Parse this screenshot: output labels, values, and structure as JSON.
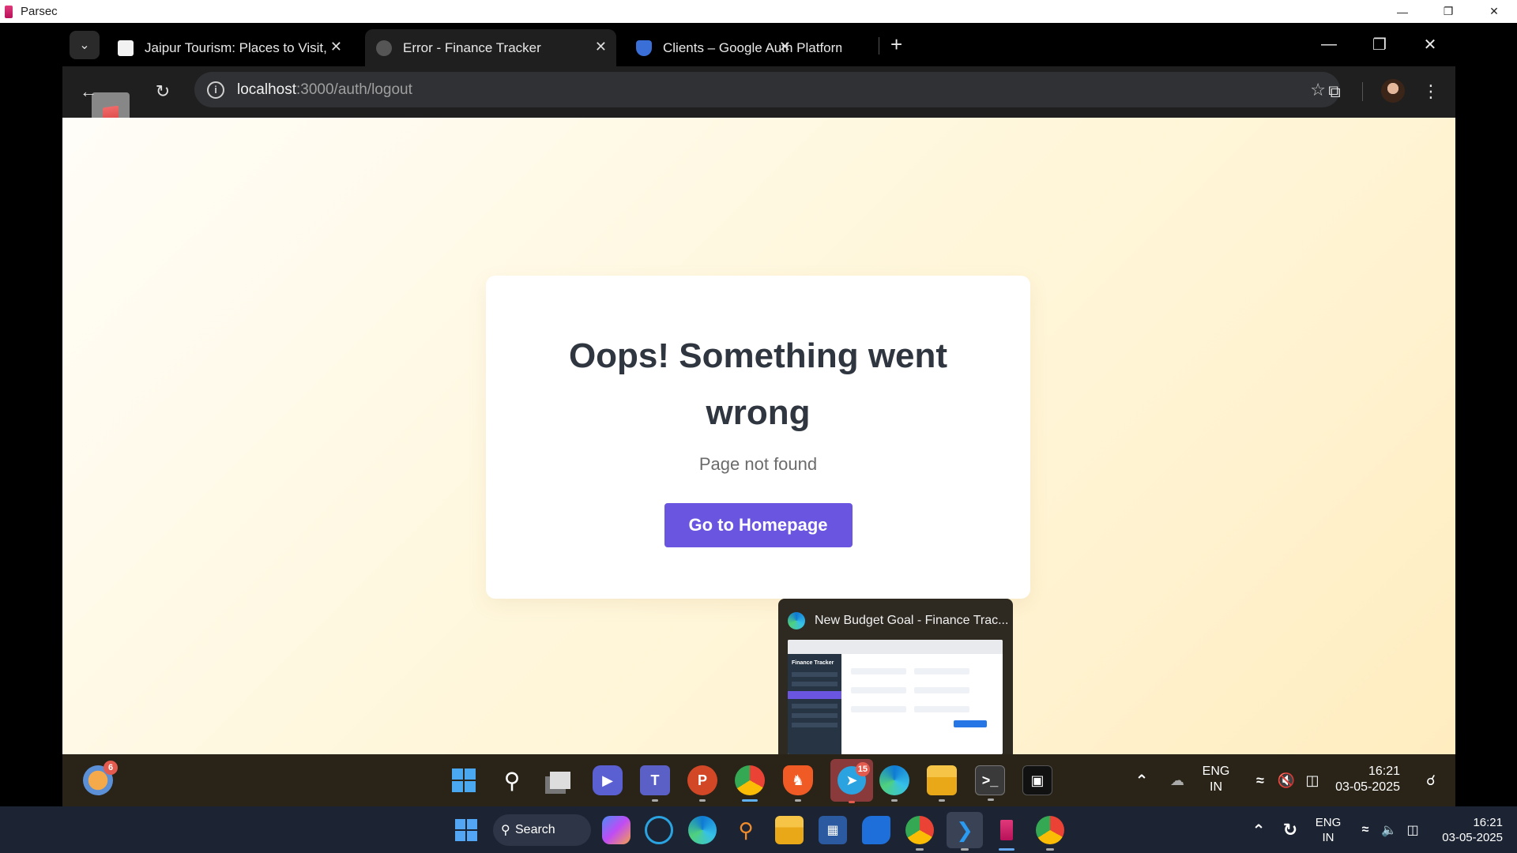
{
  "host_window": {
    "title": "Parsec",
    "controls": [
      "minimize",
      "restore",
      "close"
    ]
  },
  "browser": {
    "tabs": [
      {
        "title": "Jaipur Tourism: Places to Visit, S",
        "favicon": "jaipur-favicon-icon",
        "active": false
      },
      {
        "title": "Error - Finance Tracker",
        "favicon": "globe-icon",
        "active": true
      },
      {
        "title": "Clients – Google Auth Platform",
        "favicon": "shield-icon",
        "active": false
      }
    ],
    "url_host": "localhost",
    "url_path": ":3000/auth/logout"
  },
  "page": {
    "title": "Oops! Something went wrong",
    "message": "Page not found",
    "button_label": "Go to Homepage",
    "accent_color": "#6a55e0"
  },
  "thumbnail_popup": {
    "title": "New Budget Goal - Finance Trac...",
    "preview_app": "Finance Tracker"
  },
  "remote_taskbar": {
    "weather_badge": "6",
    "telegram_badge": "15",
    "lang_primary": "ENG",
    "lang_secondary": "IN",
    "time": "16:21",
    "date": "03-05-2025"
  },
  "host_taskbar": {
    "search_label": "Search",
    "lang_primary": "ENG",
    "lang_secondary": "IN",
    "time": "16:21",
    "date": "03-05-2025"
  }
}
